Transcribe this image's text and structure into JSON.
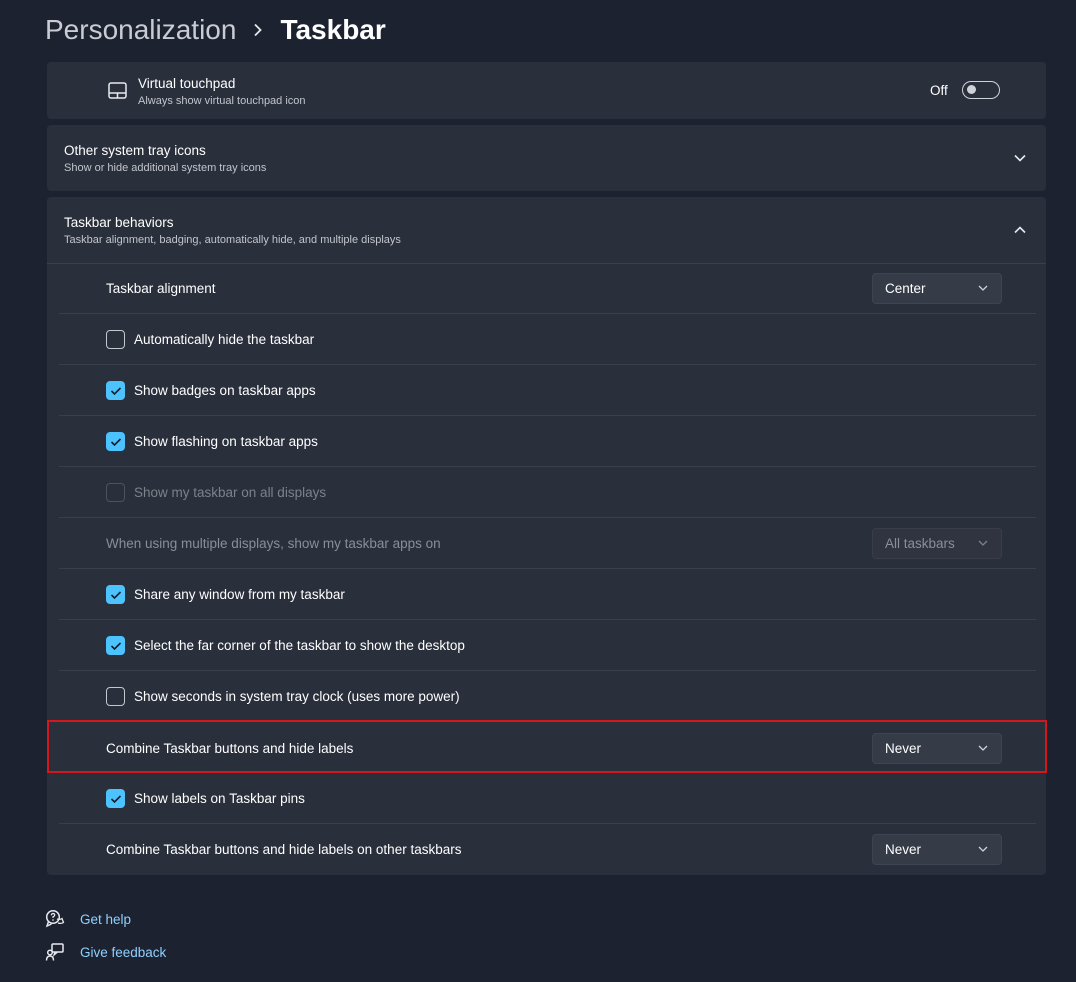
{
  "breadcrumb": {
    "parent": "Personalization",
    "current": "Taskbar"
  },
  "virtual_touchpad": {
    "icon": "touchpad-icon",
    "title": "Virtual touchpad",
    "subtitle": "Always show virtual touchpad icon",
    "toggle_label": "Off",
    "toggle_on": false
  },
  "other_tray": {
    "title": "Other system tray icons",
    "subtitle": "Show or hide additional system tray icons",
    "expanded": false
  },
  "behaviors": {
    "title": "Taskbar behaviors",
    "subtitle": "Taskbar alignment, badging, automatically hide, and multiple displays",
    "expanded": true,
    "rows": {
      "alignment": {
        "label": "Taskbar alignment",
        "value": "Center"
      },
      "auto_hide": {
        "label": "Automatically hide the taskbar",
        "checked": false
      },
      "badges": {
        "label": "Show badges on taskbar apps",
        "checked": true
      },
      "flashing": {
        "label": "Show flashing on taskbar apps",
        "checked": true
      },
      "all_displays": {
        "label": "Show my taskbar on all displays",
        "checked": false,
        "disabled": true
      },
      "multi_display": {
        "label": "When using multiple displays, show my taskbar apps on",
        "value": "All taskbars",
        "disabled": true
      },
      "share_window": {
        "label": "Share any window from my taskbar",
        "checked": true
      },
      "far_corner": {
        "label": "Select the far corner of the taskbar to show the desktop",
        "checked": true
      },
      "seconds": {
        "label": "Show seconds in system tray clock (uses more power)",
        "checked": false
      },
      "combine": {
        "label": "Combine Taskbar buttons and hide labels",
        "value": "Never"
      },
      "labels_pins": {
        "label": "Show labels on Taskbar pins",
        "checked": true
      },
      "combine_other": {
        "label": "Combine Taskbar buttons and hide labels on other taskbars",
        "value": "Never"
      }
    }
  },
  "footer": {
    "help": {
      "icon": "help-chat-icon",
      "label": "Get help"
    },
    "feedback": {
      "icon": "feedback-icon",
      "label": "Give feedback"
    }
  },
  "colors": {
    "accent": "#4cc2ff",
    "highlight_frame": "#d4161f",
    "card": "#2a2f3c",
    "background": "#1c2230",
    "link": "#8fd0ff"
  }
}
